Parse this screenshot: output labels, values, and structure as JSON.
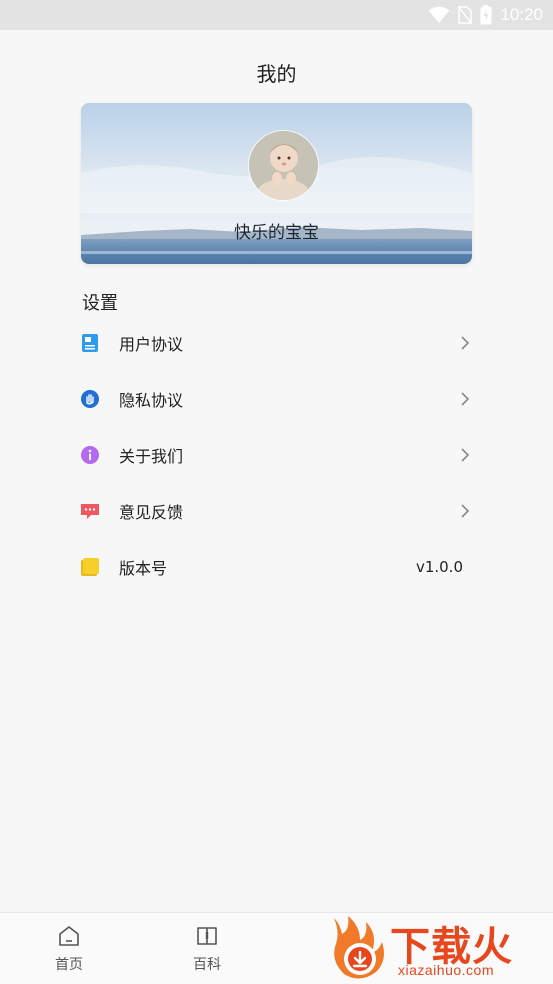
{
  "status_bar": {
    "time": "10:20"
  },
  "header": {
    "title": "我的"
  },
  "profile": {
    "username": "快乐的宝宝"
  },
  "settings": {
    "section_title": "设置",
    "items": [
      {
        "label": "用户协议",
        "icon": "document-icon",
        "color": "#2f9bf0"
      },
      {
        "label": "隐私协议",
        "icon": "hand-shield-icon",
        "color": "#1f6fd6"
      },
      {
        "label": "关于我们",
        "icon": "info-icon",
        "color": "#b36af0"
      },
      {
        "label": "意见反馈",
        "icon": "message-icon",
        "color": "#f0575f"
      },
      {
        "label": "版本号",
        "icon": "note-icon",
        "color": "#f5d02a",
        "value": "v1.0.0"
      }
    ]
  },
  "tab_bar": {
    "tabs": [
      {
        "label": "首页",
        "icon": "home-icon"
      },
      {
        "label": "百科",
        "icon": "book-icon"
      }
    ]
  },
  "watermark": {
    "text": "下载火",
    "url": "xiazaihuo.com"
  }
}
